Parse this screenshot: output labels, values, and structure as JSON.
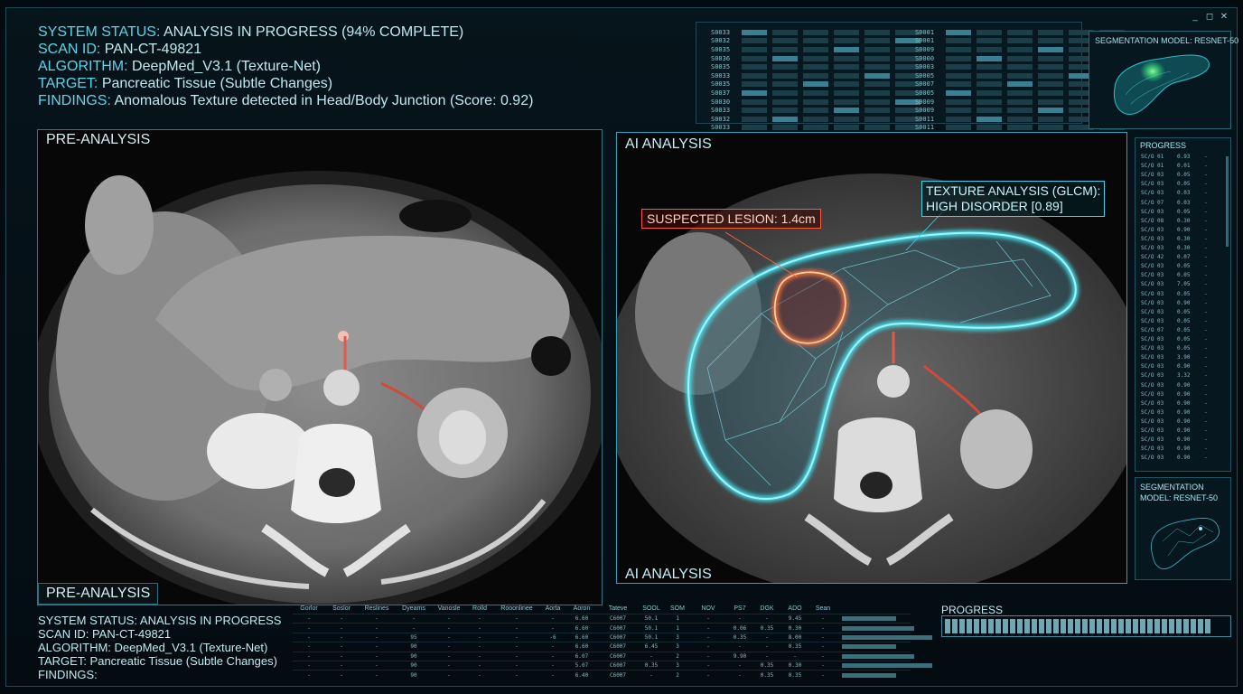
{
  "window": {
    "minimize": "_",
    "maximize": "◻",
    "close": "✕"
  },
  "status_top": {
    "status_key": "SYSTEM STATUS:",
    "status_val": " ANALYSIS IN PROGRESS (94% COMPLETE)",
    "scan_key": "SCAN ID:",
    "scan_val": " PAN-CT-49821",
    "algo_key": "ALGORITHM:",
    "algo_val": " DeepMed_V3.1 (Texture-Net)",
    "target_key": "TARGET:",
    "target_val": " Pancreatic Tissue (Subtle Changes)",
    "findings_key": "FINDINGS:",
    "findings_val": " Anomalous Texture detected in Head/Body Junction (Score: 0.92)"
  },
  "data_grid_top": {
    "col1": [
      "S0033",
      "S0032",
      "S0035",
      "S0036",
      "S0035",
      "S0033",
      "S0035",
      "S0037",
      "S0030",
      "S0033",
      "S0032",
      "S0033"
    ],
    "col2": [
      "S0001",
      "S0001",
      "S0009",
      "S0000",
      "S0003",
      "S0005",
      "S0007",
      "S0005",
      "S0009",
      "S0009",
      "S0011",
      "S0011"
    ]
  },
  "model_top": {
    "title": "SEGMENTATION MODEL: RESNET-50"
  },
  "pre_panel": {
    "label_top": "PRE-ANALYSIS",
    "label_bottom": "PRE-ANALYSIS"
  },
  "ai_panel": {
    "label_top": "AI ANALYSIS",
    "label_bottom": "AI ANALYSIS",
    "lesion_callout": "SUSPECTED LESION: 1.4cm",
    "texture_line1": "TEXTURE ANALYSIS (GLCM):",
    "texture_line2": "HIGH DISORDER [0.89]"
  },
  "progress_side": {
    "title": "PROGRESS",
    "rows": [
      [
        "SC/O 01",
        "0.93",
        "-"
      ],
      [
        "SC/O 01",
        "0.01",
        "-"
      ],
      [
        "SC/O 03",
        "0.05",
        "-"
      ],
      [
        "SC/O 03",
        "0.05",
        "-"
      ],
      [
        "SC/O 03",
        "0.03",
        "-"
      ],
      [
        "SC/O 07",
        "0.03",
        "-"
      ],
      [
        "SC/O 03",
        "0.05",
        "-"
      ],
      [
        "SC/O 08",
        "0.30",
        "-"
      ],
      [
        "SC/O 03",
        "0.90",
        "-"
      ],
      [
        "SC/O 03",
        "0.30",
        "-"
      ],
      [
        "SC/O 03",
        "0.30",
        "-"
      ],
      [
        "SC/O 42",
        "0.07",
        "-"
      ],
      [
        "SC/O 03",
        "0.05",
        "-"
      ],
      [
        "SC/O 03",
        "0.05",
        "-"
      ],
      [
        "SC/O 03",
        "7.05",
        "-"
      ],
      [
        "SC/O 03",
        "0.05",
        "-"
      ],
      [
        "SC/O 03",
        "0.90",
        "-"
      ],
      [
        "SC/O 03",
        "0.05",
        "-"
      ],
      [
        "SC/O 03",
        "0.05",
        "-"
      ],
      [
        "SC/O 07",
        "0.05",
        "-"
      ],
      [
        "SC/O 03",
        "0.05",
        "-"
      ],
      [
        "SC/O 03",
        "0.05",
        "-"
      ],
      [
        "SC/O 03",
        "3.90",
        "-"
      ],
      [
        "SC/O 03",
        "0.90",
        "-"
      ],
      [
        "SC/O 03",
        "3.32",
        "-"
      ],
      [
        "SC/O 03",
        "0.90",
        "-"
      ],
      [
        "SC/O 03",
        "0.90",
        "-"
      ],
      [
        "SC/O 03",
        "0.90",
        "-"
      ],
      [
        "SC/O 03",
        "0.90",
        "-"
      ],
      [
        "SC/O 03",
        "0.90",
        "-"
      ],
      [
        "SC/O 03",
        "0.90",
        "-"
      ],
      [
        "SC/O 03",
        "0.90",
        "-"
      ],
      [
        "SC/O 03",
        "0.90",
        "-"
      ],
      [
        "SC/O 03",
        "0.90",
        "-"
      ]
    ]
  },
  "model_side": {
    "title": "SEGMENTATION MODEL: RESNET-50"
  },
  "status_bottom": {
    "status": "SYSTEM STATUS: ANALYSIS IN PROGRESS",
    "scan": "SCAN ID: PAN-CT-49821",
    "algo": "ALGORITHM: DeepMed_V3.1 (Texture-Net)",
    "target": "TARGET: Pancreatic Tissue (Subtle Changes)",
    "findings": "FINDINGS:"
  },
  "table_bottom": {
    "headers": [
      "Gorlor",
      "Soslor",
      "Reslines",
      "Dyeams",
      "Vanosle",
      "Rolld",
      "Rooonlinee",
      "Aorta",
      "Aoron",
      "Tateve",
      "SOOL",
      "SOM",
      "NOV",
      "PS7",
      "DGK",
      "ADO",
      "Sean"
    ],
    "rows": [
      [
        "-",
        "-",
        "-",
        "-",
        "-",
        "-",
        "-",
        "-",
        "6.60",
        "C6007",
        "50.1",
        "1",
        "-",
        "-",
        "-",
        "9.45",
        "-"
      ],
      [
        "-",
        "-",
        "-",
        "-",
        "-",
        "-",
        "-",
        "-",
        "6.60",
        "C6007",
        "50.1",
        "1",
        "-",
        "0.06",
        "0.35",
        "0.30",
        "-"
      ],
      [
        "-",
        "-",
        "-",
        "95",
        "-",
        "-",
        "-",
        "-6",
        "6.60",
        "C6007",
        "50.1",
        "3",
        "-",
        "0.35",
        "-",
        "8.00",
        "-"
      ],
      [
        "-",
        "-",
        "-",
        "90",
        "-",
        "-",
        "-",
        "-",
        "6.60",
        "C6007",
        "6.45",
        "3",
        "-",
        "-",
        "-",
        "0.35",
        "-"
      ],
      [
        "-",
        "-",
        "-",
        "90",
        "-",
        "-",
        "-",
        "-",
        "6.07",
        "C6007",
        "-",
        "2",
        "-",
        "9.90",
        "-",
        "-",
        "-"
      ],
      [
        "-",
        "-",
        "-",
        "90",
        "-",
        "-",
        "-",
        "-",
        "5.07",
        "C6007",
        "0.35",
        "3",
        "-",
        "-",
        "0.35",
        "0.30",
        "-"
      ],
      [
        "-",
        "-",
        "-",
        "90",
        "-",
        "-",
        "-",
        "-",
        "6.40",
        "C6007",
        "-",
        "2",
        "-",
        "-",
        "0.35",
        "0.35",
        "-"
      ]
    ]
  },
  "progress_bottom": {
    "title": "PROGRESS",
    "fraction": 0.94
  }
}
